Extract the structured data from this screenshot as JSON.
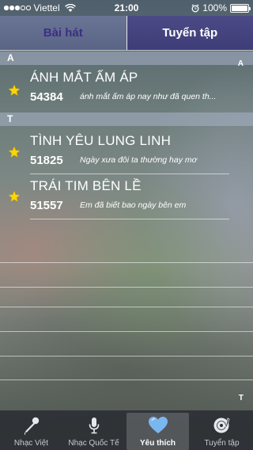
{
  "status_bar": {
    "carrier": "Viettel",
    "time": "21:00",
    "battery": "100%",
    "battery_level": 1.0,
    "signal_bars_filled": 3,
    "signal_bars_total": 5
  },
  "segment_tabs": [
    {
      "label": "Bài hát",
      "selected": false
    },
    {
      "label": "Tuyển tập",
      "selected": true
    }
  ],
  "sections": [
    {
      "letter": "A",
      "songs": [
        {
          "title": "ÁNH MẮT ẤM ÁP",
          "code": "54384",
          "lyric": "ánh mắt ấm áp nay như đã quen th...",
          "favorite": true
        }
      ]
    },
    {
      "letter": "T",
      "songs": [
        {
          "title": "TÌNH YÊU LUNG LINH",
          "code": "51825",
          "lyric": "Ngày xưa đôi ta thường hay mơ",
          "favorite": true
        },
        {
          "title": "TRÁI TIM BÊN LỀ",
          "code": "51557",
          "lyric": "Em đã biết bao ngày bên em",
          "favorite": true
        }
      ]
    }
  ],
  "section_index": [
    "A",
    "T"
  ],
  "tab_bar": [
    {
      "label": "Nhạc Việt",
      "icon": "microphone-icon",
      "active": false
    },
    {
      "label": "Nhạc Quốc Tế",
      "icon": "microphone-icon",
      "active": false
    },
    {
      "label": "Yêu thích",
      "icon": "heart-icon",
      "active": true
    },
    {
      "label": "Tuyển tập",
      "icon": "disc-icon",
      "active": false
    }
  ],
  "colors": {
    "star": "#ffd400",
    "heart": "#7ab7f0",
    "segment_selected_bg": "#45437e",
    "segment_unselected_text": "#3a2f84"
  }
}
